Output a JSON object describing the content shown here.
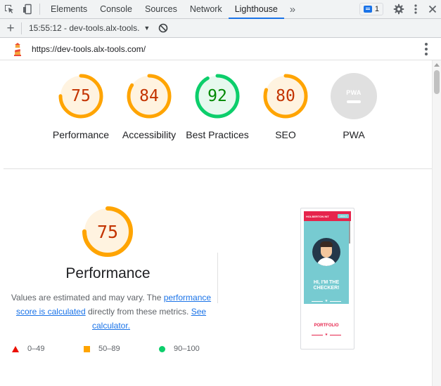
{
  "devtools": {
    "tabs": [
      "Elements",
      "Console",
      "Sources",
      "Network",
      "Lighthouse"
    ],
    "active_tab": "Lighthouse",
    "more_tabs_glyph": "»",
    "issues_count": "1",
    "icons": {
      "inspect": "inspect-element-icon",
      "device": "device-toolbar-icon",
      "issues": "issues-icon",
      "settings": "gear-icon",
      "menu": "kebab-menu-icon",
      "close": "close-icon"
    }
  },
  "report_toolbar": {
    "new_report_glyph": "+",
    "report_label": "15:55:12 - dev-tools.alx-tools.",
    "clear_icon": "clear-icon"
  },
  "url_bar": {
    "url": "https://dev-tools.alx-tools.com/",
    "logo_icon": "lighthouse-logo",
    "menu_icon": "kebab-menu-icon"
  },
  "scores": [
    {
      "label": "Performance",
      "value": "75",
      "fraction": 0.75,
      "rating": "average"
    },
    {
      "label": "Accessibility",
      "value": "84",
      "fraction": 0.84,
      "rating": "average"
    },
    {
      "label": "Best Practices",
      "value": "92",
      "fraction": 0.92,
      "rating": "pass"
    },
    {
      "label": "SEO",
      "value": "80",
      "fraction": 0.8,
      "rating": "average"
    },
    {
      "label": "PWA",
      "value": "",
      "badge_text": "PWA",
      "rating": "na"
    }
  ],
  "performance": {
    "score": "75",
    "fraction": 0.75,
    "title": "Performance",
    "desc_before": "Values are estimated and may vary. The ",
    "desc_link1": "performance score is calculated",
    "desc_middle": " directly from these metrics. ",
    "desc_link2": "See calculator.",
    "legend": [
      {
        "range": "0–49",
        "shape": "triangle",
        "color": "#eb0f00"
      },
      {
        "range": "50–89",
        "shape": "square",
        "color": "#ffa400"
      },
      {
        "range": "90–100",
        "shape": "circle",
        "color": "#0cce6b"
      }
    ]
  },
  "thumbnail": {
    "brand": "HOLBERTON INT",
    "button": "ABOUT",
    "hero_text": "HI, I'M THE CHECKER!",
    "section": "PORTFOLIO"
  },
  "colors": {
    "average_fg": "#c33300",
    "average_ring": "#ffa400",
    "average_bg": "#fff3e0",
    "pass_fg": "#008800",
    "pass_ring": "#0cce6b",
    "pass_bg": "#e6f9ee",
    "accent": "#1a73e8"
  }
}
